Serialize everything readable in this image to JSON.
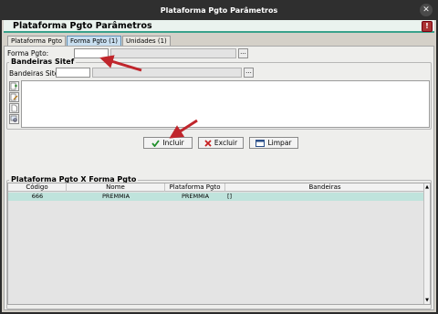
{
  "window": {
    "title": "Plataforma Pgto Parâmetros",
    "close_symbol": "✕"
  },
  "panel": {
    "title": "Plataforma Pgto Parâmetros",
    "help_symbol": "!"
  },
  "tabs": [
    {
      "label": "Plataforma Pgto",
      "active": false
    },
    {
      "label": "Forma Pgto (1)",
      "active": true
    },
    {
      "label": "Unidades (1)",
      "active": false
    }
  ],
  "form": {
    "forma_pgto_label": "Forma Pgto:",
    "forma_pgto_value": "",
    "forma_pgto_desc": "",
    "lookup_symbol": "..."
  },
  "bandeiras": {
    "legend": "Bandeiras Sitef",
    "field_label": "Bandeiras Sitef:",
    "code_value": "",
    "desc_value": "",
    "lookup_symbol": "..."
  },
  "actions": {
    "include_label": "Incluir",
    "delete_label": "Excluir",
    "clear_label": "Limpar"
  },
  "grid": {
    "legend": "Plataforma Pgto X Forma Pgto",
    "columns": [
      "Código",
      "Nome",
      "Plataforma Pgto",
      "Bandeiras"
    ],
    "rows": [
      {
        "codigo": "666",
        "nome": "PREMMIA",
        "plataforma": "PREMMIA",
        "bandeiras": "[]"
      }
    ]
  },
  "colors": {
    "accent": "#3aa28c",
    "selected_row": "#bfe3dc",
    "annotation_arrow": "#c0262c"
  }
}
